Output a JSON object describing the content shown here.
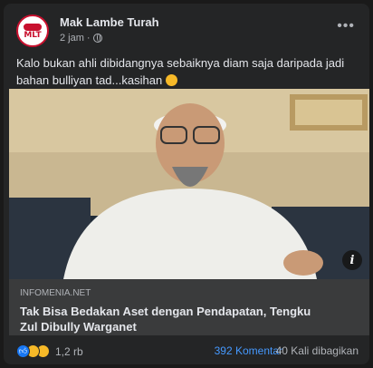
{
  "post": {
    "page_name": "Mak Lambe Turah",
    "avatar_text": "MLT",
    "time": "2 jam",
    "caption": "Kalo bukan ahli dibidangnya sebaiknya diam saja daripada jadi bahan bulliyan tad...kasihan",
    "caption_emoji": "smiling-face-emoji"
  },
  "link": {
    "domain": "INFOMENIA.NET",
    "title": "Tak Bisa Bedakan Aset dengan Pendapatan, Tengku Zul Dibully Warganet"
  },
  "footer": {
    "reaction_count": "1,2 rb",
    "comments": "392 Komentar",
    "shares": "40 Kali dibagikan"
  },
  "icons": {
    "more": "more-options-icon",
    "privacy": "globe-icon",
    "info": "info-icon",
    "reactions": [
      "like-icon",
      "haha-icon",
      "wow-icon"
    ]
  },
  "colors": {
    "card": "#242526",
    "link_box": "#3a3b3c",
    "brand_red": "#c8102e",
    "like_blue": "#1877f2",
    "comment_link": "#4599ff"
  }
}
